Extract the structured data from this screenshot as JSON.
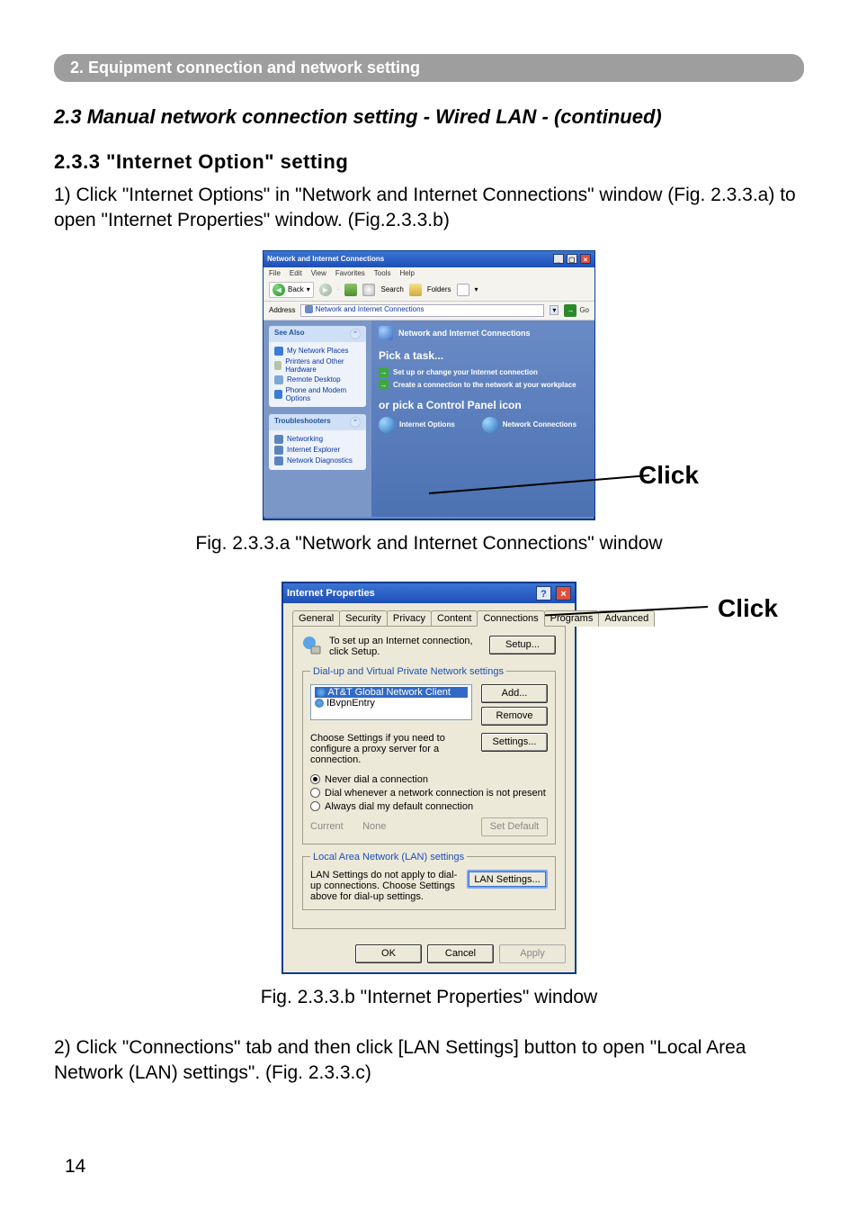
{
  "chapter_bar": "2. Equipment connection and network setting",
  "section_title": "2.3 Manual network connection setting - Wired LAN - (continued)",
  "subsection_title": "2.3.3 \"Internet Option\" setting",
  "step1": "1) Click \"Internet Options\" in \"Network and Internet Connections\" window (Fig. 2.3.3.a) to open \"Internet Properties\" window. (Fig.2.3.3.b)",
  "caption_a": "Fig. 2.3.3.a \"Network and Internet Connections\" window",
  "caption_b": "Fig. 2.3.3.b \"Internet Properties\" window",
  "step2": "2) Click \"Connections\" tab and then click [LAN Settings] button to open \"Local Area Network (LAN) settings\". (Fig. 2.3.3.c)",
  "click_label_a": "Click",
  "click_label_b": "Click",
  "page_number": "14",
  "figA": {
    "title": "Network and Internet Connections",
    "menubar": [
      "File",
      "Edit",
      "View",
      "Favorites",
      "Tools",
      "Help"
    ],
    "toolbar": {
      "back": "Back",
      "search": "Search",
      "folders": "Folders"
    },
    "address_label": "Address",
    "address_value": "Network and Internet Connections",
    "go": "Go",
    "see_also_hdr": "See Also",
    "see_also_items": [
      "My Network Places",
      "Printers and Other Hardware",
      "Remote Desktop",
      "Phone and Modem Options"
    ],
    "trouble_hdr": "Troubleshooters",
    "trouble_items": [
      "Networking",
      "Internet Explorer",
      "Network Diagnostics"
    ],
    "main_title": "Network and Internet Connections",
    "pick_task": "Pick a task...",
    "task1": "Set up or change your Internet connection",
    "task2": "Create a connection to the network at your workplace",
    "or_pick": "or pick a Control Panel icon",
    "cp1": "Internet Options",
    "cp2": "Network Connections"
  },
  "figB": {
    "title": "Internet Properties",
    "tabs": [
      "General",
      "Security",
      "Privacy",
      "Content",
      "Connections",
      "Programs",
      "Advanced"
    ],
    "setup_text": "To set up an Internet connection, click Setup.",
    "setup_btn": "Setup...",
    "fieldset1_legend": "Dial-up and Virtual Private Network settings",
    "list_item1": "AT&T Global Network Client",
    "list_item2": "IBvpnEntry",
    "add_btn": "Add...",
    "remove_btn": "Remove",
    "settings_text": "Choose Settings if you need to configure a proxy server for a connection.",
    "settings_btn": "Settings...",
    "radio1": "Never dial a connection",
    "radio2": "Dial whenever a network connection is not present",
    "radio3": "Always dial my default connection",
    "current_label": "Current",
    "current_value": "None",
    "set_default_btn": "Set Default",
    "fieldset2_legend": "Local Area Network (LAN) settings",
    "lan_text": "LAN Settings do not apply to dial-up connections. Choose Settings above for dial-up settings.",
    "lan_btn": "LAN Settings...",
    "ok_btn": "OK",
    "cancel_btn": "Cancel",
    "apply_btn": "Apply"
  }
}
